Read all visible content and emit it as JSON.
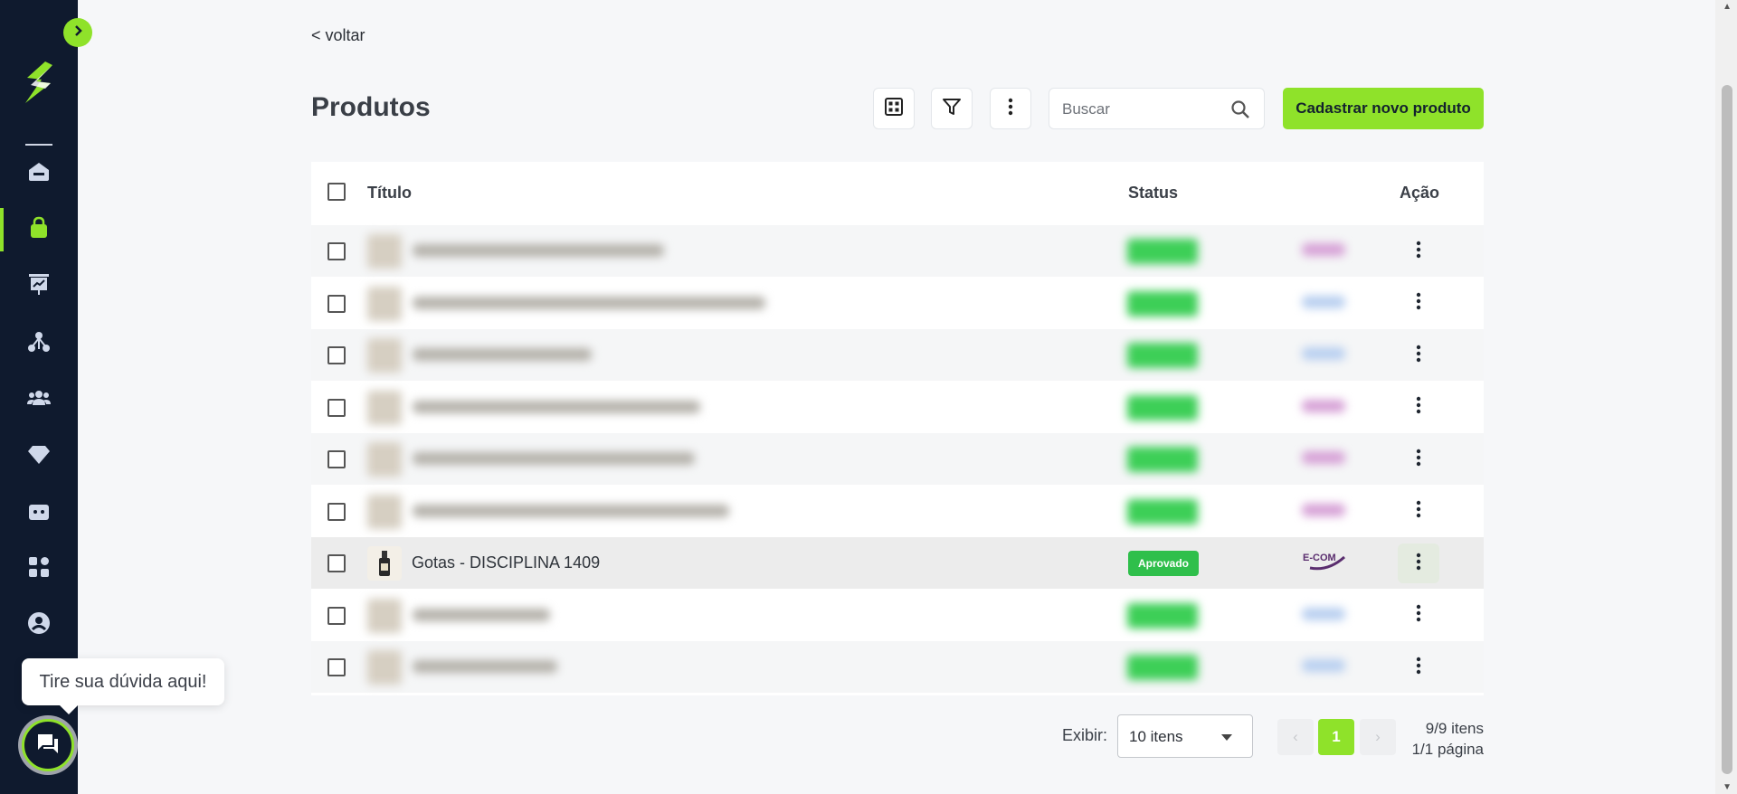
{
  "sidebar": {
    "toggle_icon": "chevron-right-icon",
    "items": [
      {
        "name": "home",
        "icon": "home-icon"
      },
      {
        "name": "products",
        "icon": "shopping-bag-icon",
        "active": true
      },
      {
        "name": "reports",
        "icon": "presentation-chart-icon"
      },
      {
        "name": "affiliates",
        "icon": "network-icon"
      },
      {
        "name": "customers",
        "icon": "users-icon"
      },
      {
        "name": "club",
        "icon": "diamond-icon"
      },
      {
        "name": "finance",
        "icon": "wallet-icon"
      },
      {
        "name": "apps",
        "icon": "apps-grid-icon"
      },
      {
        "name": "account",
        "icon": "user-circle-icon"
      }
    ]
  },
  "help": {
    "tooltip": "Tire sua dúvida aqui!"
  },
  "header": {
    "back_label": "< voltar",
    "title": "Produtos",
    "search_placeholder": "Buscar",
    "new_product_label": "Cadastrar novo produto"
  },
  "table": {
    "columns": {
      "title": "Título",
      "status": "Status",
      "action": "Ação"
    },
    "rows": [
      {
        "visible": false,
        "title_width": 278,
        "channel_color": "#d6a0d6"
      },
      {
        "visible": false,
        "title_width": 390,
        "channel_color": "#b8cff0"
      },
      {
        "visible": false,
        "title_width": 198,
        "channel_color": "#b8cff0"
      },
      {
        "visible": false,
        "title_width": 318,
        "channel_color": "#d6a0d6"
      },
      {
        "visible": false,
        "title_width": 312,
        "channel_color": "#d6a0d6"
      },
      {
        "visible": false,
        "title_width": 350,
        "channel_color": "#d6a0d6"
      },
      {
        "visible": true,
        "title": "Gotas - DISCIPLINA 1409",
        "status": "Aprovado",
        "channel": "E-COM"
      },
      {
        "visible": false,
        "title_width": 152,
        "channel_color": "#b8cff0"
      },
      {
        "visible": false,
        "title_width": 160,
        "channel_color": "#b8cff0"
      }
    ]
  },
  "pagination": {
    "show_label": "Exibir:",
    "per_page": "10 itens",
    "current_page": "1",
    "items_info": "9/9 itens",
    "page_info": "1/1 página"
  },
  "colors": {
    "accent": "#8fe22a",
    "sidebar_bg": "#0f1a2e",
    "status_approved": "#2fbf4b"
  }
}
